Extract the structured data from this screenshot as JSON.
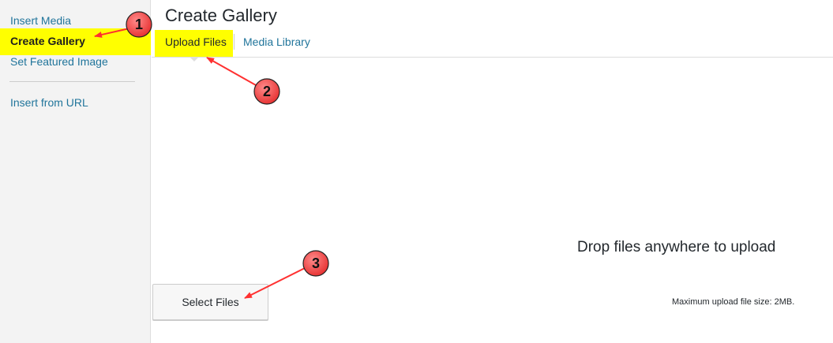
{
  "sidebar": {
    "items": [
      {
        "label": "Insert Media"
      },
      {
        "label": "Create Gallery"
      },
      {
        "label": "Set Featured Image"
      },
      {
        "label": "Insert from URL"
      }
    ]
  },
  "frame": {
    "title": "Create Gallery",
    "tabs": [
      {
        "label": "Upload Files"
      },
      {
        "label": "Media Library"
      }
    ]
  },
  "uploader": {
    "drop_text": "Drop files anywhere to upload",
    "select_button": "Select Files",
    "max_size": "Maximum upload file size: 2MB."
  },
  "annotations": {
    "color": "#ff4545",
    "badges": [
      {
        "label": "1"
      },
      {
        "label": "2"
      },
      {
        "label": "3"
      }
    ]
  },
  "colors": {
    "highlight": "#ffff00",
    "link": "#21759b"
  }
}
